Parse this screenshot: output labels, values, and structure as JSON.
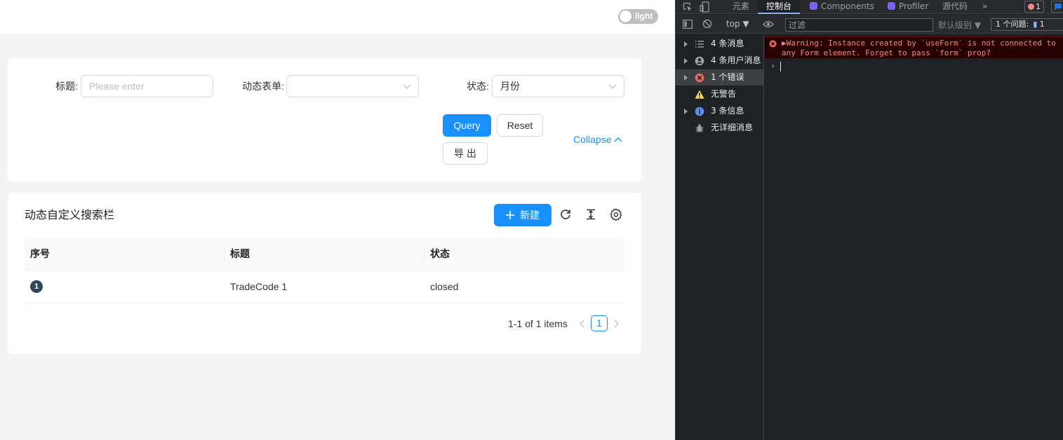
{
  "app": {
    "theme_toggle": {
      "label": "light"
    },
    "search_form": {
      "title_label": "标题:",
      "title_placeholder": "Please enter",
      "dynamic_form_label": "动态表单:",
      "dynamic_form_value": "",
      "status_label": "状态:",
      "status_value": "月份",
      "query_label": "Query",
      "reset_label": "Reset",
      "export_label": "导 出",
      "collapse_label": "Collapse"
    },
    "table": {
      "title": "动态自定义搜索栏",
      "new_button_label": "新建",
      "columns": [
        "序号",
        "标题",
        "状态"
      ],
      "rows": [
        {
          "index": "1",
          "title": "TradeCode 1",
          "status": "closed"
        }
      ],
      "pagination": {
        "total_text": "1-1 of 1 items",
        "current_page": "1"
      }
    },
    "colors": {
      "primary": "#1890ff",
      "background": "#f4f4f4"
    }
  },
  "devtools": {
    "tabs": [
      "元素",
      "控制台",
      "Components",
      "Profiler",
      "源代码"
    ],
    "active_tab": "控制台",
    "more_tabs": "»",
    "error_count": "1",
    "message_count": "",
    "toolbar": {
      "context": "top ▼",
      "filter_placeholder": "过滤",
      "level": "默认级别 ▼",
      "issues_label": "1 个问题:",
      "issues_count": "1"
    },
    "sidebar": [
      {
        "label": "4 条消息",
        "icon": "list-icon",
        "expandable": true
      },
      {
        "label": "4 条用户消息",
        "icon": "user-icon",
        "expandable": true
      },
      {
        "label": "1 个错误",
        "icon": "error-icon",
        "expandable": true
      },
      {
        "label": "无警告",
        "icon": "warning-icon",
        "expandable": false
      },
      {
        "label": "3 条信息",
        "icon": "info-icon",
        "expandable": true
      },
      {
        "label": "无详细消息",
        "icon": "bug-icon",
        "expandable": false
      }
    ],
    "console_messages": [
      {
        "level": "error",
        "text": "▶Warning: Instance created by `useForm` is not connected to any Form element. Forget to pass `form` prop?"
      }
    ],
    "prompt": "›"
  }
}
